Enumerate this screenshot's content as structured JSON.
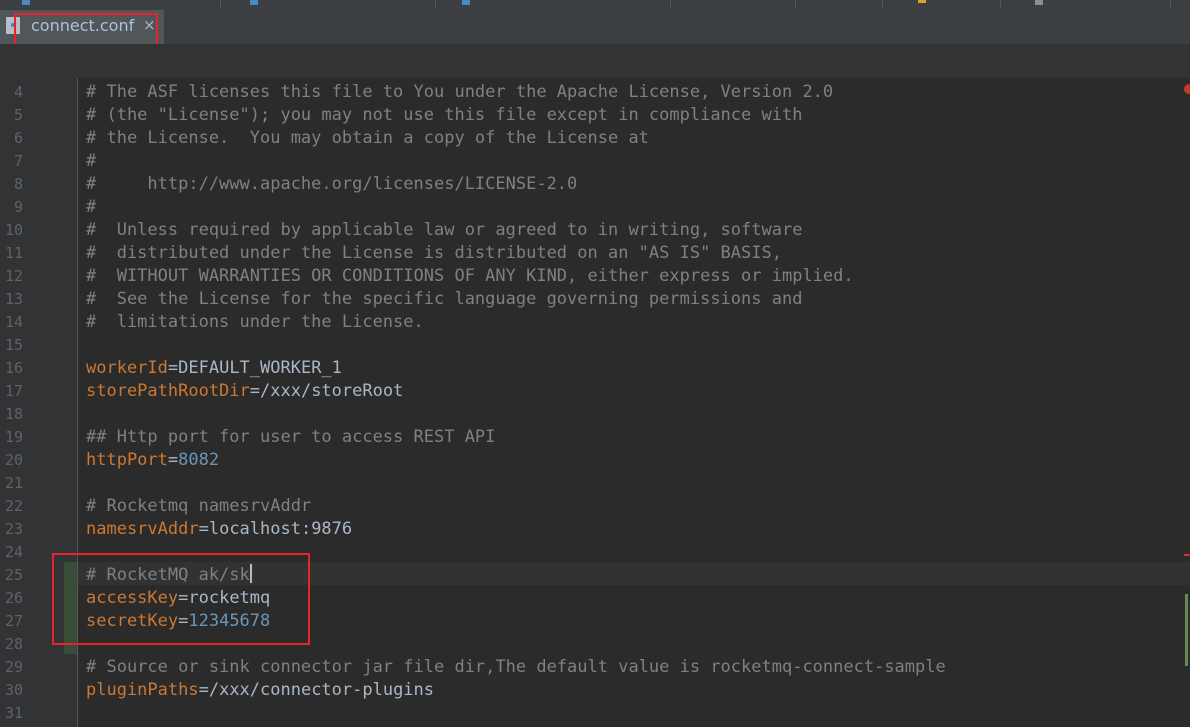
{
  "tab": {
    "title": "connect.conf",
    "close": "×"
  },
  "gutter": {
    "line_numbers": [
      "4",
      "5",
      "6",
      "7",
      "8",
      "9",
      "10",
      "11",
      "12",
      "13",
      "14",
      "15",
      "16",
      "17",
      "18",
      "19",
      "20",
      "21",
      "22",
      "23",
      "24",
      "25",
      "26",
      "27",
      "28",
      "29",
      "30",
      "31"
    ]
  },
  "code": {
    "l4": "# The ASF licenses this file to You under the Apache License, Version 2.0",
    "l5": "# (the \"License\"); you may not use this file except in compliance with",
    "l6": "# the License.  You may obtain a copy of the License at",
    "l7": "#",
    "l8": "#     http://www.apache.org/licenses/LICENSE-2.0",
    "l9": "#",
    "l10": "#  Unless required by applicable law or agreed to in writing, software",
    "l11": "#  distributed under the License is distributed on an \"AS IS\" BASIS,",
    "l12": "#  WITHOUT WARRANTIES OR CONDITIONS OF ANY KIND, either express or implied.",
    "l13": "#  See the License for the specific language governing permissions and",
    "l14": "#  limitations under the License.",
    "l16_key": "workerId",
    "l16_val": "DEFAULT_WORKER_1",
    "l17_key": "storePathRootDir",
    "l17_val": "/xxx/storeRoot",
    "l19": "## Http port for user to access REST API",
    "l20_key": "httpPort",
    "l20_val": "8082",
    "l22": "# Rocketmq namesrvAddr",
    "l23_key": "namesrvAddr",
    "l23_val": "localhost:9876",
    "l25": "# RocketMQ ak/sk",
    "l26_key": "accessKey",
    "l26_val": "rocketmq",
    "l27_key": "secretKey",
    "l27_val": "12345678",
    "l29": "# Source or sink connector jar file dir,The default value is rocketmq-connect-sample",
    "l30_key": "pluginPaths",
    "l30_val": "/xxx/connector-plugins",
    "eq": "="
  },
  "colors": {
    "background": "#2b2b2b",
    "comment": "#808080",
    "key": "#cc7832",
    "number": "#6897bb",
    "text": "#a9b7c6",
    "highlight_box": "#e8232c"
  }
}
